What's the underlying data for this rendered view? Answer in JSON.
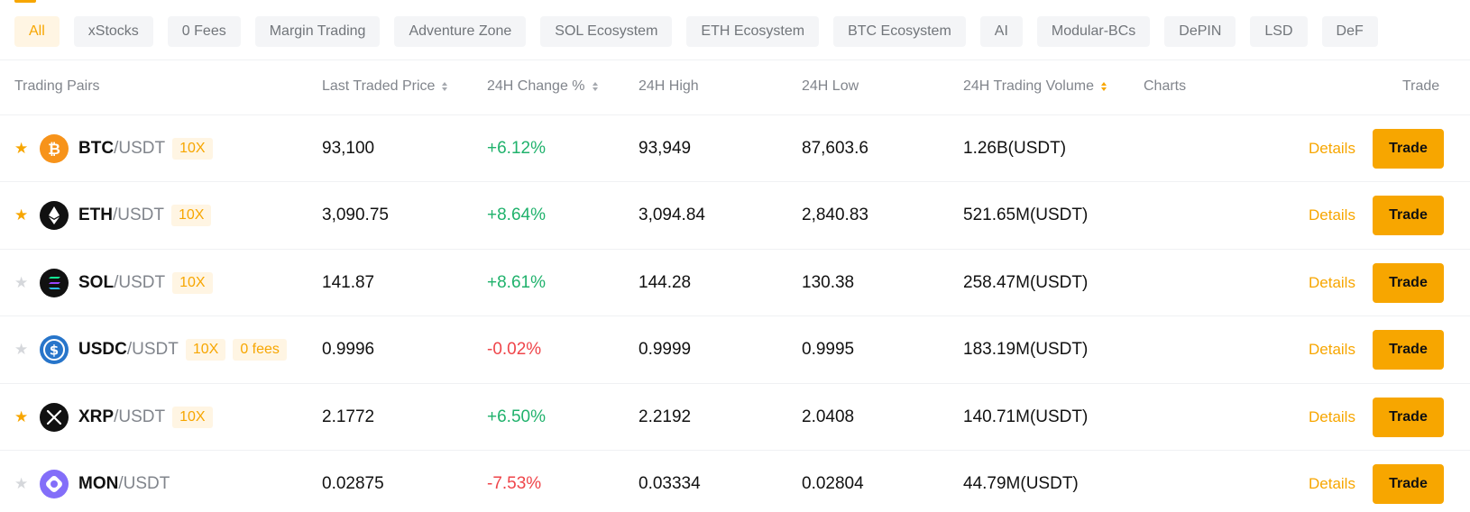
{
  "filters": [
    {
      "label": "All",
      "active": true
    },
    {
      "label": "xStocks"
    },
    {
      "label": "0 Fees"
    },
    {
      "label": "Margin Trading"
    },
    {
      "label": "Adventure Zone"
    },
    {
      "label": "SOL Ecosystem"
    },
    {
      "label": "ETH Ecosystem"
    },
    {
      "label": "BTC Ecosystem"
    },
    {
      "label": "AI"
    },
    {
      "label": "Modular-BCs"
    },
    {
      "label": "DePIN"
    },
    {
      "label": "LSD"
    },
    {
      "label": "DeF"
    }
  ],
  "columns": {
    "pairs": "Trading Pairs",
    "last_price": "Last Traded Price",
    "change": "24H Change %",
    "high": "24H High",
    "low": "24H Low",
    "volume": "24H Trading Volume",
    "charts": "Charts",
    "trade": "Trade"
  },
  "actions": {
    "details_label": "Details",
    "trade_label": "Trade"
  },
  "colors": {
    "accent": "#f7a600",
    "up": "#20b26c",
    "down": "#ef454a"
  },
  "rows": [
    {
      "base": "BTC",
      "quote": "/USDT",
      "tags": [
        "10X"
      ],
      "price": "93,100",
      "change": "+6.12%",
      "direction": "up",
      "high": "93,949",
      "low": "87,603.6",
      "volume": "1.26B(USDT)",
      "favorite": true,
      "icon": "btc-icon"
    },
    {
      "base": "ETH",
      "quote": "/USDT",
      "tags": [
        "10X"
      ],
      "price": "3,090.75",
      "change": "+8.64%",
      "direction": "up",
      "high": "3,094.84",
      "low": "2,840.83",
      "volume": "521.65M(USDT)",
      "favorite": true,
      "icon": "eth-icon"
    },
    {
      "base": "SOL",
      "quote": "/USDT",
      "tags": [
        "10X"
      ],
      "price": "141.87",
      "change": "+8.61%",
      "direction": "up",
      "high": "144.28",
      "low": "130.38",
      "volume": "258.47M(USDT)",
      "favorite": false,
      "icon": "sol-icon"
    },
    {
      "base": "USDC",
      "quote": "/USDT",
      "tags": [
        "10X",
        "0 fees"
      ],
      "price": "0.9996",
      "change": "-0.02%",
      "direction": "down",
      "high": "0.9999",
      "low": "0.9995",
      "volume": "183.19M(USDT)",
      "favorite": false,
      "icon": "usdc-icon"
    },
    {
      "base": "XRP",
      "quote": "/USDT",
      "tags": [
        "10X"
      ],
      "price": "2.1772",
      "change": "+6.50%",
      "direction": "up",
      "high": "2.2192",
      "low": "2.0408",
      "volume": "140.71M(USDT)",
      "favorite": true,
      "icon": "xrp-icon"
    },
    {
      "base": "MON",
      "quote": "/USDT",
      "tags": [],
      "price": "0.02875",
      "change": "-7.53%",
      "direction": "down",
      "high": "0.03334",
      "low": "0.02804",
      "volume": "44.79M(USDT)",
      "favorite": false,
      "icon": "mon-icon"
    }
  ]
}
